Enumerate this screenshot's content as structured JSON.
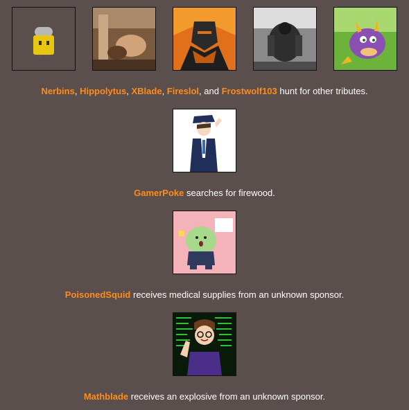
{
  "events": [
    {
      "tributes": [
        "Nerbins",
        "Hippolytus",
        "XBlade",
        "Fireslol",
        "Frostwolf103"
      ],
      "separators": [
        ", ",
        ", ",
        ", ",
        ", and "
      ],
      "action": " hunt for other tributes."
    },
    {
      "tributes": [
        "GamerPoke"
      ],
      "action": " searches for firewood."
    },
    {
      "tributes": [
        "PoisonedSquid"
      ],
      "action": " receives medical supplies from an unknown sponsor."
    },
    {
      "tributes": [
        "Mathblade"
      ],
      "action": " receives an explosive from an unknown sponsor."
    }
  ],
  "colors": {
    "background": "#5b4f4d",
    "tribute_name": "#ff8c1a",
    "text": "#ffffff"
  }
}
